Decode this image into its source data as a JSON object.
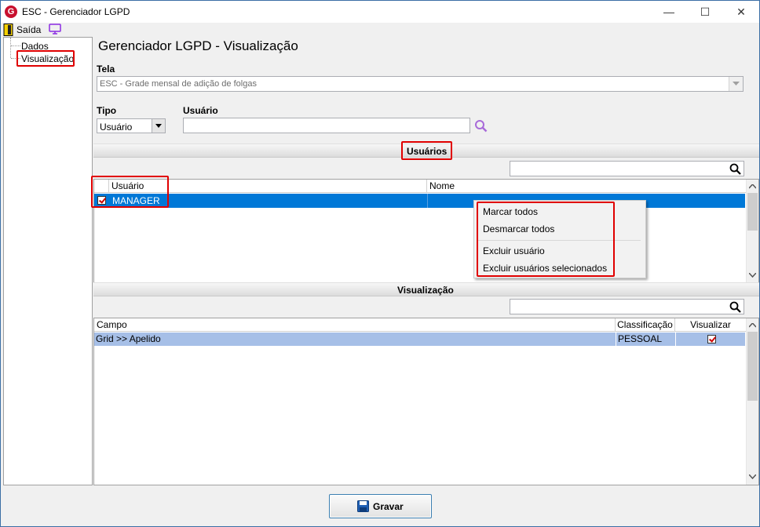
{
  "window": {
    "title": "ESC - Gerenciador LGPD",
    "minimize": "—",
    "maximize": "☐",
    "close": "✕"
  },
  "menubar": {
    "exit_label": "Saída"
  },
  "tree": {
    "items": [
      {
        "label": "Dados"
      },
      {
        "label": "Visualização"
      }
    ]
  },
  "header": {
    "title": "Gerenciador LGPD - Visualização"
  },
  "tela": {
    "label": "Tela",
    "value": "ESC - Grade mensal de adição de folgas"
  },
  "tipo": {
    "label": "Tipo",
    "value": "Usuário"
  },
  "usuario": {
    "label": "Usuário",
    "value": ""
  },
  "users_section": {
    "title": "Usuários",
    "search_value": "",
    "columns": [
      "Usuário",
      "Nome"
    ],
    "rows": [
      {
        "checked": true,
        "usuario": "MANAGER",
        "nome": ""
      }
    ]
  },
  "context_menu": {
    "items": [
      "Marcar todos",
      "Desmarcar todos",
      "Excluir usuário",
      "Excluir usuários selecionados"
    ]
  },
  "view_section": {
    "title": "Visualização",
    "search_value": "",
    "columns": [
      "Campo",
      "Classificação",
      "Visualizar"
    ],
    "rows": [
      {
        "campo": "Grid >> Apelido",
        "classificacao": "PESSOAL",
        "visualizar": true
      }
    ]
  },
  "footer": {
    "save_label": "Gravar"
  },
  "colors": {
    "selection": "#0078d7",
    "row_highlight": "#a6bfe7",
    "highlight_box": "#e00000"
  }
}
